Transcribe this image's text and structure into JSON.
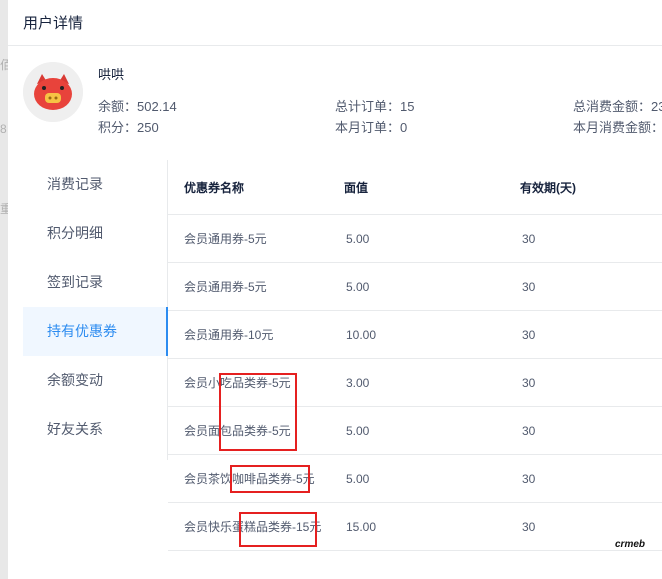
{
  "ghost": {
    "chars": [
      "佰",
      "8",
      "重"
    ]
  },
  "header": {
    "title": "用户详情"
  },
  "user": {
    "nickname": "哄哄",
    "balance": "余额：502.14",
    "points": "积分：250",
    "total_orders": "总计订单：15",
    "month_orders": "本月订单：0",
    "total_spent": "总消费金额：23",
    "month_spent": "本月消费金额："
  },
  "tabs": [
    {
      "label": "消费记录"
    },
    {
      "label": "积分明细"
    },
    {
      "label": "签到记录"
    },
    {
      "label": "持有优惠券",
      "active": true
    },
    {
      "label": "余额变动"
    },
    {
      "label": "好友关系"
    }
  ],
  "table": {
    "columns": [
      "优惠券名称",
      "面值",
      "有效期(天)"
    ],
    "rows": [
      [
        "会员通用券-5元",
        "5.00",
        "30"
      ],
      [
        "会员通用券-5元",
        "5.00",
        "30"
      ],
      [
        "会员通用券-10元",
        "10.00",
        "30"
      ],
      [
        "会员小吃品类券-5元",
        "3.00",
        "30"
      ],
      [
        "会员面包品类券-5元",
        "5.00",
        "30"
      ],
      [
        "会员茶饮咖啡品类券-5元",
        "5.00",
        "30"
      ],
      [
        "会员快乐蛋糕品类券-15元",
        "15.00",
        "30"
      ]
    ]
  },
  "logo": {
    "text": "crmeb"
  },
  "colors": {
    "accent": "#2d8cf0",
    "annotation": "#e52020"
  }
}
